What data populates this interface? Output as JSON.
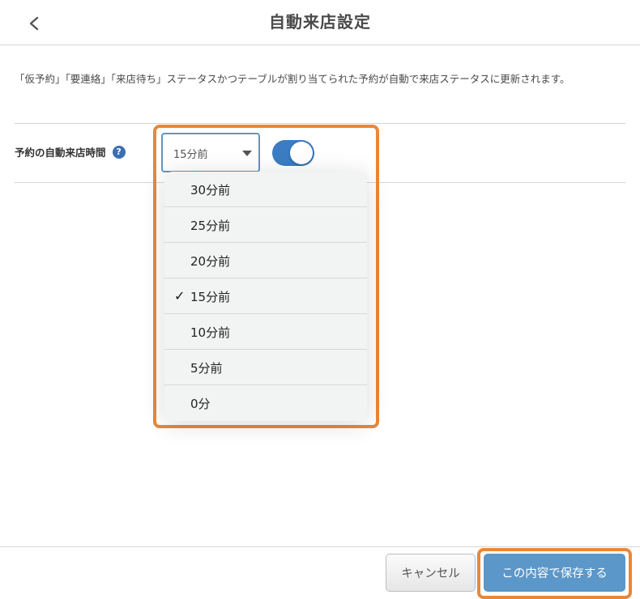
{
  "header": {
    "title": "自動来店設定",
    "back_icon": "chevron-left-icon"
  },
  "description": "「仮予約」「要連絡」「来店待ち」ステータスかつテーブルが割り当てられた予約が自動で来店ステータスに更新されます。",
  "setting": {
    "label": "予約の自動来店時間",
    "help_icon_text": "?",
    "select_value": "15分前",
    "toggle_on": true,
    "options": [
      "30分前",
      "25分前",
      "20分前",
      "15分前",
      "10分前",
      "5分前",
      "0分"
    ],
    "selected_index": 3,
    "check_mark": "✓"
  },
  "footer": {
    "cancel_label": "キャンセル",
    "save_label": "この内容で保存する"
  },
  "colors": {
    "accent": "#5b97c9",
    "toggle": "#3b7cc4",
    "highlight": "#e8883a",
    "help_icon": "#3b6fb0"
  }
}
